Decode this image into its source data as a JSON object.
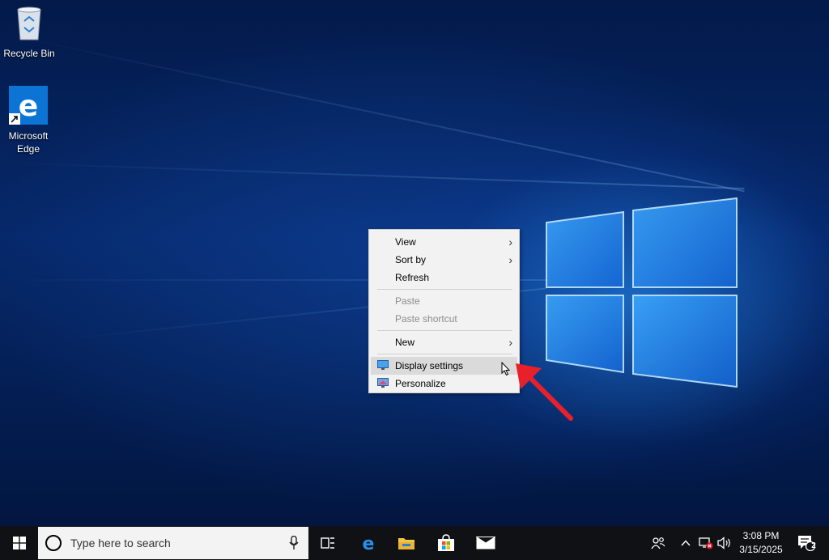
{
  "desktop_icons": [
    {
      "label": "Recycle Bin",
      "icon": "recycle-bin-icon"
    },
    {
      "label_line1": "Microsoft",
      "label_line2": "Edge",
      "icon": "edge-icon"
    }
  ],
  "context_menu": {
    "view": "View",
    "sort_by": "Sort by",
    "refresh": "Refresh",
    "paste": "Paste",
    "paste_shortcut": "Paste shortcut",
    "new": "New",
    "display_settings": "Display settings",
    "personalize": "Personalize"
  },
  "taskbar": {
    "search_placeholder": "Type here to search",
    "time": "3:08 PM",
    "date": "3/15/2025",
    "notification_count": "2"
  },
  "colors": {
    "accent": "#0078d7",
    "taskbar": "#101114",
    "menu_bg": "#f2f2f2",
    "arrow": "#e8202a"
  }
}
